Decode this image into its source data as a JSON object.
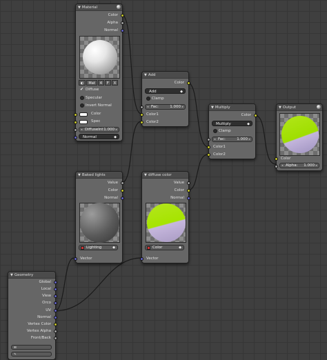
{
  "nodes": {
    "material": {
      "title": "Material",
      "outputs": [
        "Color",
        "Alpha",
        "Normal"
      ],
      "mat_selector": [
        "Mat",
        "4",
        "F",
        "X"
      ],
      "diffuse": "Diffuse",
      "specular": "Specular",
      "invert_normal": "Invert Normal",
      "inputs": [
        "Color",
        "Spec"
      ],
      "diffuse_intensity": {
        "label": "DiffuseInt",
        "value": "1.000"
      },
      "normal_input": "Normal"
    },
    "add": {
      "title": "Add",
      "output": "Color",
      "blend_mode": "Add",
      "clamp": "Clamp",
      "fac": {
        "label": "Fac:",
        "value": "1.000"
      },
      "inputs": [
        "Color1",
        "Color2"
      ]
    },
    "multiply": {
      "title": "Multiply",
      "output": "Color",
      "blend_mode": "Multiply",
      "clamp": "Clamp",
      "fac": {
        "label": "Fac:",
        "value": "1.000"
      },
      "inputs": [
        "Color1",
        "Color2"
      ]
    },
    "output": {
      "title": "Output",
      "input_color": "Color",
      "alpha": {
        "label": "Alpha:",
        "value": "1.000"
      }
    },
    "baked_lights": {
      "title": "Baked lights",
      "outputs": [
        "Value",
        "Color",
        "Normal"
      ],
      "texture": "Lighting",
      "input": "Vector"
    },
    "diffuse_color": {
      "title": "diffuse color",
      "outputs": [
        "Value",
        "Color",
        "Normal"
      ],
      "texture": "Color",
      "input": "Vector"
    },
    "geometry": {
      "title": "Geometry",
      "outputs": [
        "Global",
        "Local",
        "View",
        "Orco",
        "UV",
        "Normal",
        "Vertex Color",
        "Vertex Alpha",
        "Front/Back"
      ]
    }
  }
}
